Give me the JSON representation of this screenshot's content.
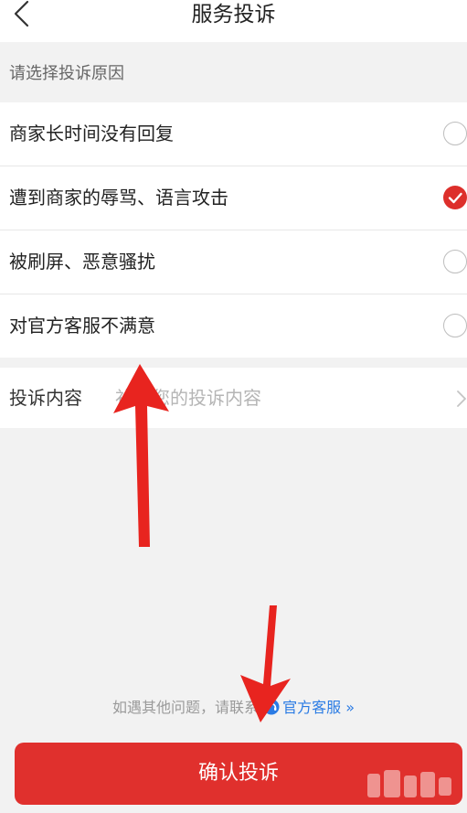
{
  "header": {
    "title": "服务投诉",
    "back_icon": "chevron-left-icon"
  },
  "reason_section": {
    "label": "请选择投诉原因"
  },
  "reasons": [
    {
      "label": "商家长时间没有回复",
      "checked": false
    },
    {
      "label": "遭到商家的辱骂、语言攻击",
      "checked": true
    },
    {
      "label": "被刷屏、恶意骚扰",
      "checked": false
    },
    {
      "label": "对官方客服不满意",
      "checked": false
    }
  ],
  "content_row": {
    "label": "投诉内容",
    "placeholder": "补充您的投诉内容",
    "chevron_icon": "chevron-right-icon"
  },
  "footer": {
    "note_prefix": "如遇其他问题，请联系",
    "link_label": "官方客服",
    "link_suffix": "»",
    "link_icon": "headset-icon"
  },
  "confirm_button": {
    "label": "确认投诉"
  },
  "colors": {
    "accent_red": "#e0302d",
    "link_blue": "#2a7be4",
    "background": "#f2f2f2",
    "annotation_arrow": "#e8241f"
  },
  "annotations": {
    "arrow_icon": "red-arrow-icon"
  }
}
